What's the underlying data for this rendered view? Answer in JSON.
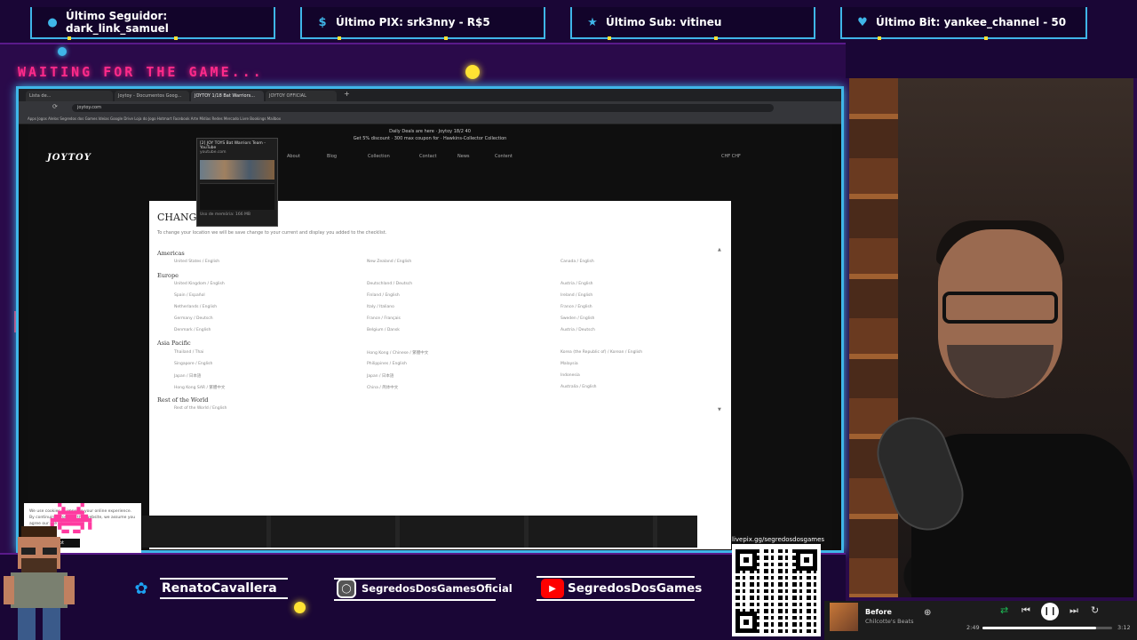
{
  "overlay": {
    "alerts": [
      {
        "label": "Último Seguidor: dark_link_samuel",
        "icon": "user-icon"
      },
      {
        "label": "Último PIX: srk3nny - R$5",
        "icon": "dollar-icon"
      },
      {
        "label": "Último Sub: vitineu",
        "icon": "star-icon"
      },
      {
        "label": "Último Bit: yankee_channel - 50",
        "icon": "diamond-icon"
      }
    ],
    "waiting_text": "WAITING FOR THE GAME...",
    "socials": [
      {
        "label": "RenatoCavallera",
        "icon": "twitter-icon",
        "color": "#1da1f2"
      },
      {
        "label": "SegredosDosGamesOficial",
        "icon": "instagram-icon",
        "color": "#555555"
      },
      {
        "label": "SegredosDosGames",
        "icon": "youtube-icon",
        "color": "#ff0000"
      }
    ],
    "qr_label": "livepix.gg/segredosdosgames"
  },
  "browser": {
    "tabs": [
      {
        "label": "Lista de..."
      },
      {
        "label": "Joytoy - Documentos Goog..."
      },
      {
        "label": "JOYTOY 1/18 Bat Warriors..."
      },
      {
        "label": "JOYTOY OFFICIAL"
      }
    ],
    "url": "joytoy.com",
    "bookmarks": "Apps  Jogos  Alelos  Segredos dos Games  Ideias  Google Drive  Loja do Jogo  Hotmart  Facebook  Arte  Mídias  Redes  Mercado Livre  Bookings  Mailbox",
    "tab_preview": {
      "title": "[2] JOY TOYS Bat Warriors Team - YouTube",
      "domain": "youtube.com",
      "footer": "Uso de memória: 166 MB"
    }
  },
  "page": {
    "promo_line1": "Daily Deals are here · Joytoy 18/2 40",
    "promo_line2": "Get 5% discount · 300 max coupon for · Hawkins-Collector Collection",
    "logo": "JOYTOY",
    "nav": [
      "About",
      "Blog",
      "Collection",
      "Contact",
      "News",
      "Content"
    ],
    "header_right": "CHF CHF",
    "cookie_text": "We use cookies to improve your online experience. By continuing browsing this website, we assume you agree our use of cookies.",
    "cookie_button": "I accept"
  },
  "modal": {
    "title": "CHANGE",
    "subtitle": "To change your location we will be save change to your current and display you added to the checklist.",
    "regions": [
      {
        "name": "Americas",
        "countries": [
          "United States / English",
          "New Zealand / English",
          "Canada / English"
        ]
      },
      {
        "name": "Europe",
        "countries": [
          "United Kingdom / English",
          "Deutschland / Deutsch",
          "Austria / English",
          "Spain / Español",
          "Finland / English",
          "Ireland / English",
          "Netherlands / English",
          "Italy / Italiano",
          "France / English",
          "Germany / Deutsch",
          "France / Français",
          "Sweden / English",
          "Denmark / English",
          "Belgium / Dansk",
          "Austria / Deutsch"
        ]
      },
      {
        "name": "Asia Pacific",
        "countries": [
          "Thailand / Thai",
          "Hong Kong / Chinese / 繁體中文",
          "Korea (the Republic of) / Korean / English",
          "Singapore / English",
          "Philippines / English",
          "Malaysia",
          "Japan / 日本語",
          "Japan / 日本語",
          "Indonesia",
          "Hong Kong SAR / 繁體中文",
          "China / 简体中文",
          "Australia / English"
        ]
      },
      {
        "name": "Rest of the World",
        "countries": [
          "Rest of the World / English"
        ]
      }
    ]
  },
  "player": {
    "song": "Before",
    "artist": "Chilcotte's Beats",
    "time_elapsed": "2:49",
    "time_total": "3:12",
    "progress": 0.88
  }
}
